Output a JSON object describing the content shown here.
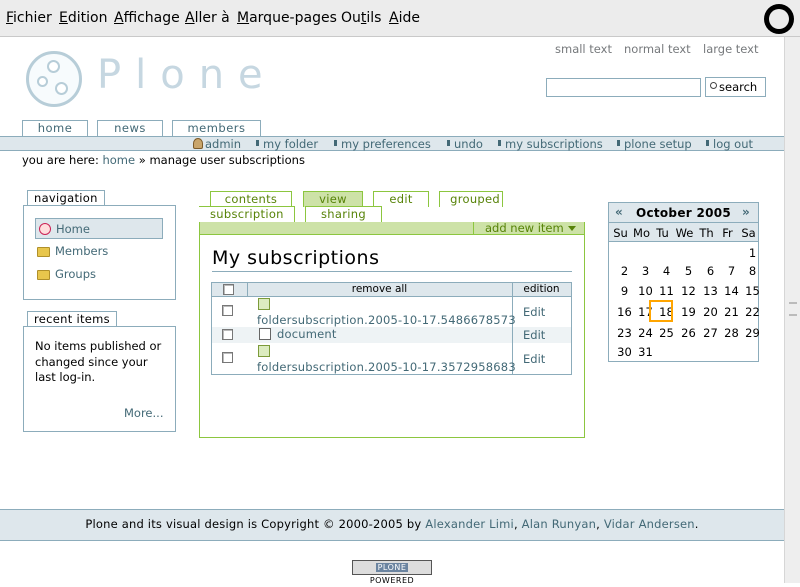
{
  "browser_menu": [
    {
      "label": "Fichier",
      "key": "F",
      "rest": "ichier"
    },
    {
      "label": "Edition",
      "key": "E",
      "rest": "dition"
    },
    {
      "label": "Affichage",
      "key": "A",
      "rest": "ffichage"
    },
    {
      "label": "Aller à",
      "key": "A",
      "rest": "ller à"
    },
    {
      "label": "Marque-pages",
      "key": "M",
      "rest": "arque-pages"
    },
    {
      "label": "Outils",
      "key": "O",
      "rest": "u",
      "key2": "t",
      "rest2": "ils"
    },
    {
      "label": "Aide",
      "key": "A",
      "rest": "ide"
    }
  ],
  "site_actions": {
    "small": "small text",
    "normal": "normal text",
    "large": "large text"
  },
  "logo_text": "Plone",
  "search": {
    "button": "search",
    "value": ""
  },
  "portal_tabs": [
    "home",
    "news",
    "members"
  ],
  "personal_bar": [
    "admin",
    "my folder",
    "my preferences",
    "undo",
    "my subscriptions",
    "plone setup",
    "log out"
  ],
  "breadcrumbs": {
    "prefix": "you are here:",
    "home": "home",
    "sep": "»",
    "current": "manage user subscriptions"
  },
  "navigation": {
    "title": "navigation",
    "items": [
      "Home",
      "Members",
      "Groups"
    ]
  },
  "recent": {
    "title": "recent items",
    "text_lines": [
      "No items published or",
      "changed since your",
      "last log-in."
    ],
    "more": "More..."
  },
  "content_tabs": [
    "contents",
    "view",
    "edit",
    "grouped",
    "subscription",
    "sharing"
  ],
  "add_new_item": "add new item",
  "page_title": "My subscriptions",
  "table": {
    "headers": {
      "remove": "remove all",
      "edition": "edition"
    },
    "rows": [
      {
        "name": "foldersubscription.2005-10-17.5486678573",
        "edit": "Edit",
        "icon": "folder-subscription-icon"
      },
      {
        "name": "document",
        "edit": "Edit",
        "icon": "document-icon"
      },
      {
        "name": "foldersubscription.2005-10-17.3572958683",
        "edit": "Edit",
        "icon": "folder-subscription-icon"
      }
    ]
  },
  "calendar": {
    "month": "October 2005",
    "prev": "«",
    "next": "»",
    "dow": [
      "Su",
      "Mo",
      "Tu",
      "We",
      "Th",
      "Fr",
      "Sa"
    ],
    "weeks": [
      [
        "",
        "",
        "",
        "",
        "",
        "",
        "1"
      ],
      [
        "2",
        "3",
        "4",
        "5",
        "6",
        "7",
        "8"
      ],
      [
        "9",
        "10",
        "11",
        "12",
        "13",
        "14",
        "15"
      ],
      [
        "16",
        "17",
        "18",
        "19",
        "20",
        "21",
        "22"
      ],
      [
        "23",
        "24",
        "25",
        "26",
        "27",
        "28",
        "29"
      ],
      [
        "30",
        "31",
        "",
        "",
        "",
        "",
        ""
      ]
    ],
    "today": "18"
  },
  "footer": {
    "prefix": "Plone and its visual design is Copyright © 2000-2005 by",
    "authors": [
      "Alexander Limi",
      "Alan Runyan",
      "Vidar Andersen"
    ],
    "sep1": ",",
    "sep2": ",",
    "end": "."
  },
  "powered_badge": {
    "left": "PLONE",
    "right": "POWERED"
  },
  "colors": {
    "accent": "#8cacbb",
    "link": "#436976",
    "content_green": "#8cc63f",
    "today": "#ffa500"
  }
}
